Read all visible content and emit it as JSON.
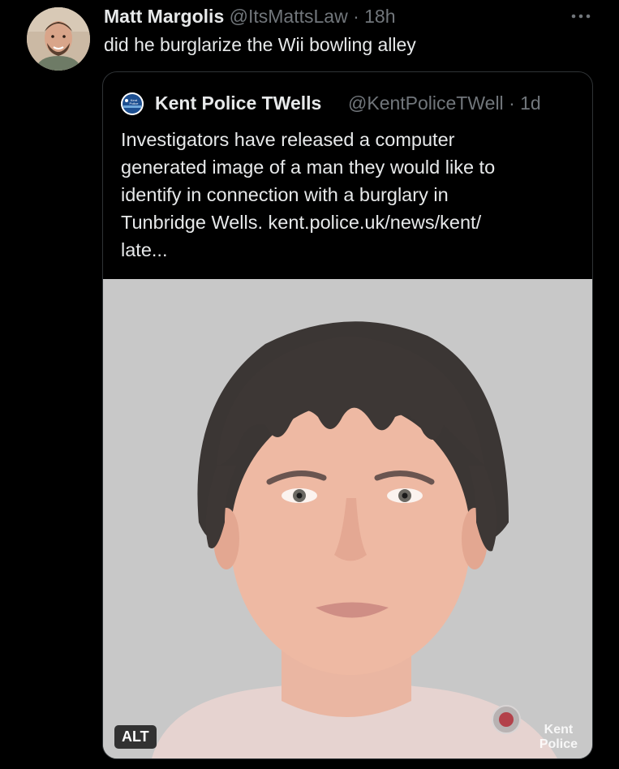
{
  "tweet": {
    "author_name": "Matt Margolis",
    "author_handle": "@ItsMattsLaw",
    "separator": "·",
    "time": "18h",
    "more_icon": "more-horizontal-icon",
    "text": "did he burglarize the Wii bowling alley"
  },
  "quoted_tweet": {
    "author_name": "Kent Police TWells",
    "author_handle": "@KentPoliceTWell",
    "separator": "·",
    "time": "1d",
    "text_lines": [
      "Investigators have released a computer",
      "generated image of a man they would like to",
      "identify in connection with a burglary in",
      "Tunbridge Wells. kent.police.uk/news/kent/",
      "late..."
    ],
    "media": {
      "alt_badge": "ALT",
      "watermark_line1": "Kent",
      "watermark_line2": "Police",
      "avatar_line1": "Kent",
      "avatar_line2": "Police"
    }
  },
  "colors": {
    "background": "#000000",
    "text_primary": "#e7e9ea",
    "text_secondary": "#71767b",
    "border": "#2f3336",
    "media_background": "#c9c9c9"
  }
}
